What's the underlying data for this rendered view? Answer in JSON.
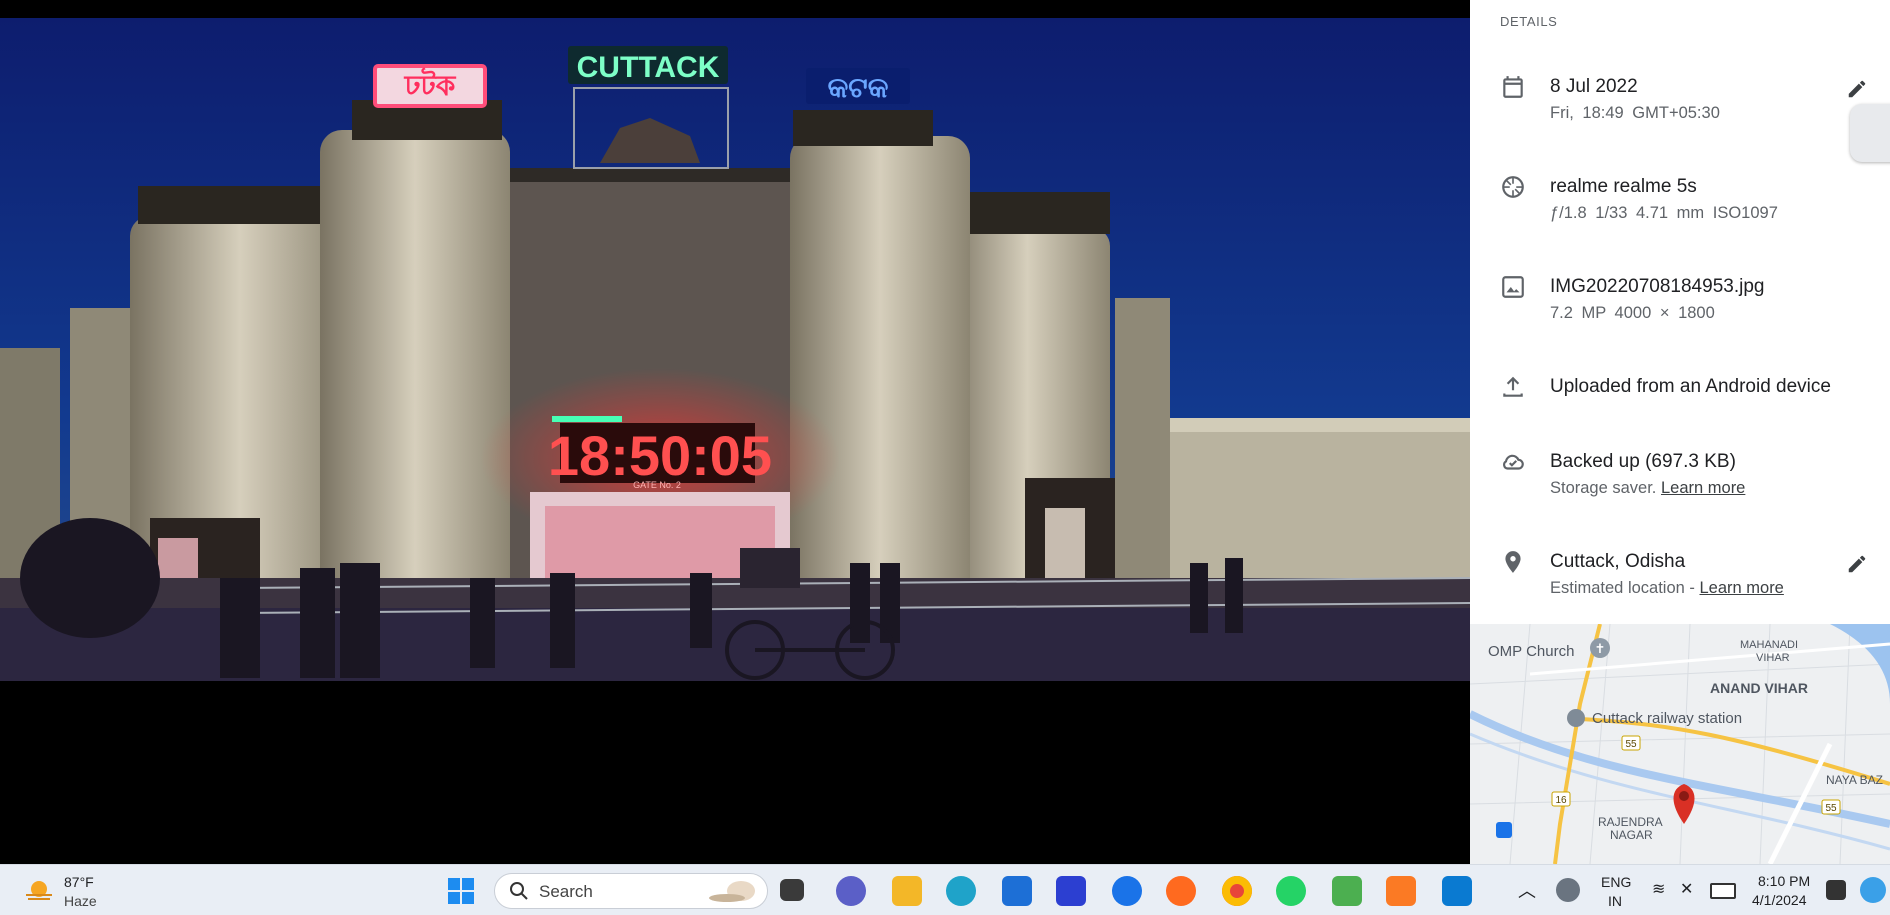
{
  "details": {
    "title": "DETAILS",
    "date": {
      "primary": "8 Jul 2022",
      "secondary": "Fri, 18:49   GMT+05:30"
    },
    "camera": {
      "primary": "realme realme 5s",
      "secondary": "ƒ/1.8   1/33   4.71 mm   ISO1097"
    },
    "file": {
      "primary": "IMG20220708184953.jpg",
      "secondary": "7.2 MP   4000 × 1800"
    },
    "upload": {
      "primary": "Uploaded from an Android device"
    },
    "backup": {
      "primary": "Backed up (697.3 KB)",
      "secondary_prefix": "Storage saver. ",
      "link": "Learn more"
    },
    "location": {
      "primary": "Cuttack, Odisha",
      "secondary_prefix": "Estimated location - ",
      "link": "Learn more"
    }
  },
  "photo": {
    "sign_left": "ঢটক",
    "sign_top": "CUTTACK",
    "sign_right": "କଟକ",
    "clock": "18:50:05",
    "gate": "GATE No. 2"
  },
  "map": {
    "labels": {
      "omp": "OMP Church",
      "mahanadi1": "MAHANADI",
      "mahanadi2": "VIHAR",
      "anand": "ANAND VIHAR",
      "station": "Cuttack railway station",
      "naya": "NAYA BAZ",
      "rajendra1": "RAJENDRA",
      "rajendra2": "NAGAR"
    },
    "roads": {
      "r55a": "55",
      "r55b": "55",
      "r16": "16"
    }
  },
  "taskbar": {
    "weather": {
      "temp": "87°F",
      "cond": "Haze"
    },
    "search_label": "Search",
    "lang": {
      "l1": "ENG",
      "l2": "IN"
    },
    "clock": {
      "time": "8:10 PM",
      "date": "4/1/2024"
    }
  },
  "colors": {
    "accent": "#1a73e8",
    "pin": "#d93025",
    "clock_red": "#ff2a2a",
    "sign_green": "#7dffc7"
  }
}
